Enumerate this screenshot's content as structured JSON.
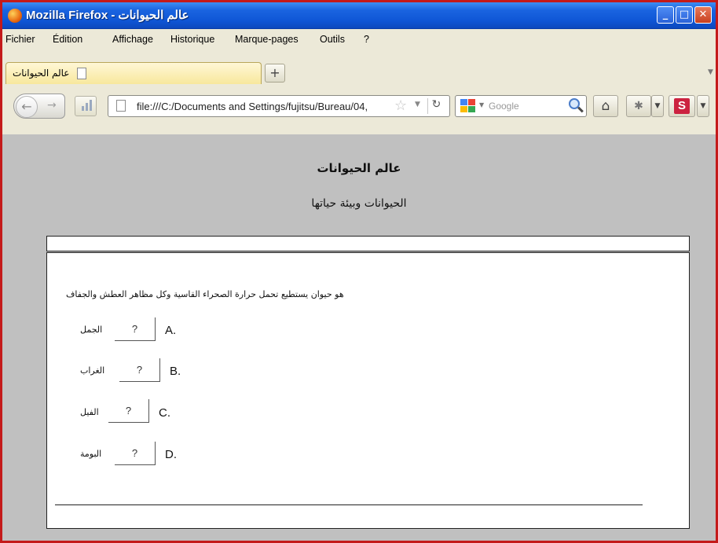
{
  "window": {
    "title": "Mozilla Firefox - عالم الحيوانات"
  },
  "menu": {
    "items": [
      "Fichier",
      "Édition",
      "Affichage",
      "Historique",
      "Marque-pages",
      "Outils",
      "?"
    ]
  },
  "tab": {
    "title": "عالم الحيوانات",
    "new_tab_label": "+"
  },
  "nav": {
    "url": "file:///C:/Documents and Settings/fujitsu/Bureau/04,",
    "search_placeholder": "Google",
    "icons": [
      "back-icon",
      "forward-icon",
      "page-icon",
      "star-icon",
      "reload-icon",
      "google-icon",
      "magnifier-icon",
      "home-icon",
      "addon-icon",
      "s-addon-icon"
    ]
  },
  "page": {
    "title": "عالم الحيوانات",
    "subtitle": "الحيوانات وبيئة حياتها",
    "question": "هو حيوان يستطيع تحمل حرارة الصحراء القاسية وكل مظاهر العطش والجفاف",
    "options": [
      {
        "letter": "A.",
        "button": "?",
        "label": "الجمل"
      },
      {
        "letter": "B.",
        "button": "?",
        "label": "الغراب"
      },
      {
        "letter": "C.",
        "button": "?",
        "label": "الفيل"
      },
      {
        "letter": "D.",
        "button": "?",
        "label": "البومة"
      }
    ]
  },
  "colors": {
    "titlebar": "#0f56d6",
    "chrome": "#ECE9D8",
    "content_bg": "#c0c0c0",
    "frame_border": "#c41a1a"
  }
}
